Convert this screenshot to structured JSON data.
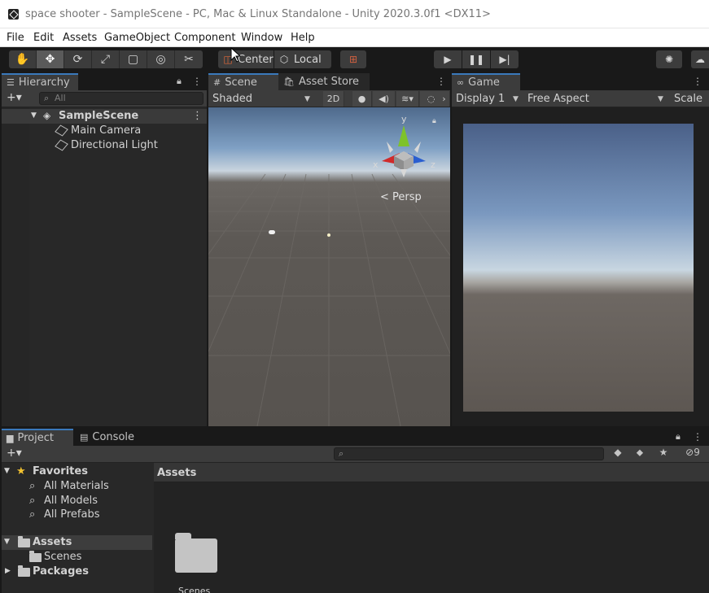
{
  "window": {
    "title": "space shooter - SampleScene - PC, Mac & Linux Standalone - Unity 2020.3.0f1 <DX11>"
  },
  "menu": [
    "File",
    "Edit",
    "Assets",
    "GameObject",
    "Component",
    "Window",
    "Help"
  ],
  "toolbar": {
    "tools": [
      {
        "icon": "hand-tool-icon",
        "glyph": "✋"
      },
      {
        "icon": "move-tool-icon",
        "glyph": "✥"
      },
      {
        "icon": "rotate-tool-icon",
        "glyph": "⟳"
      },
      {
        "icon": "scale-tool-icon",
        "glyph": "⤢"
      },
      {
        "icon": "rect-tool-icon",
        "glyph": "▢"
      },
      {
        "icon": "transform-tool-icon",
        "glyph": "◎"
      },
      {
        "icon": "custom-tool-icon",
        "glyph": "✂"
      }
    ],
    "pivot_label": "Center",
    "space_label": "Local"
  },
  "hierarchy": {
    "tab_label": "Hierarchy",
    "search_placeholder": "All",
    "scene_name": "SampleScene",
    "items": [
      "Main Camera",
      "Directional Light"
    ]
  },
  "scene_view": {
    "tabs": [
      "Scene",
      "Asset Store"
    ],
    "shading_mode": "Shaded",
    "mode_2d_label": "2D",
    "gizmo_axes": {
      "y": "y",
      "x": "x",
      "z": "z"
    },
    "projection_label": "Persp"
  },
  "game_view": {
    "tab_label": "Game",
    "display": "Display 1",
    "aspect": "Free Aspect",
    "scale_label": "Scale"
  },
  "project": {
    "tabs": [
      "Project",
      "Console"
    ],
    "hidden_count": "9",
    "favorites": {
      "label": "Favorites",
      "items": [
        "All Materials",
        "All Models",
        "All Prefabs"
      ]
    },
    "assets_label": "Assets",
    "assets_children": [
      "Scenes"
    ],
    "packages_label": "Packages",
    "breadcrumb": "Assets",
    "grid_items": [
      "Scenes"
    ]
  },
  "colors": {
    "accent_tab": "#3a79bb",
    "gizmo_y": "#7ec22a",
    "gizmo_x": "#d02a2a",
    "gizmo_z": "#2a5ed0",
    "favorite_star": "#f2c230"
  }
}
